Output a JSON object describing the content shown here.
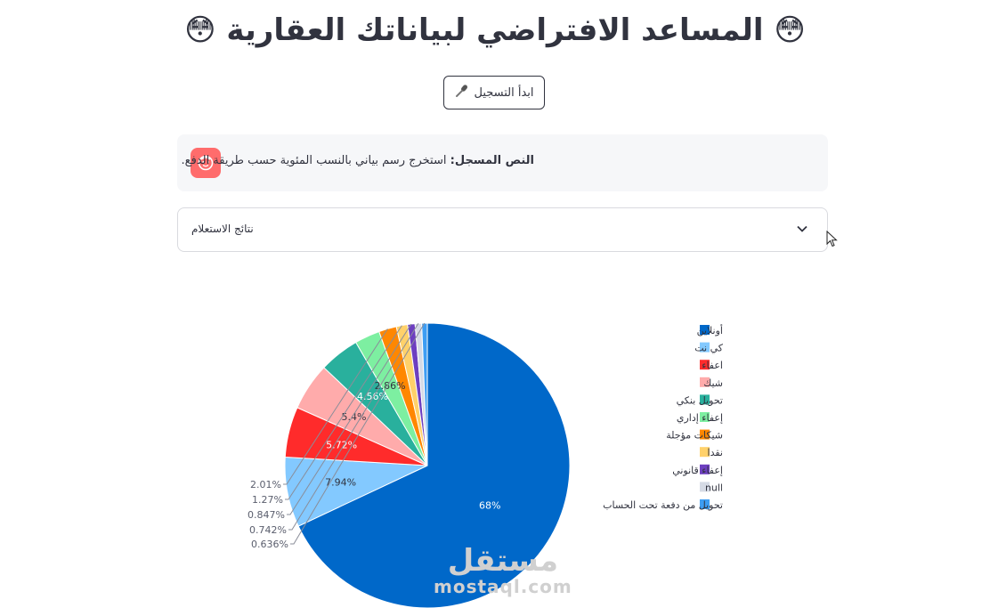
{
  "header": {
    "title": "😳 المساعد الافتراضي لبياناتك العقارية 😳"
  },
  "record_button": {
    "label": "ابدأ التسجيل",
    "icon": "microphone-icon"
  },
  "chat": {
    "prefix": "النص المسجل:",
    "message": "استخرج رسم بياني بالنسب المئوية حسب طريقة الدفع.",
    "avatar_color": "#ff6c6c"
  },
  "expander": {
    "label": "نتائج الاستعلام"
  },
  "watermark": {
    "arabic": "مستقل",
    "latin": "mostaql.com"
  },
  "chart_data": {
    "type": "pie",
    "labels": [
      "أونلاين",
      "كي نت",
      "اعفاء",
      "شيك",
      "تحويل بنكي",
      "إعفاء إداري",
      "شيكات مؤجلة",
      "نقدا",
      "إعفاء قانوني",
      "null",
      "تحويل من دفعة تحت الحساب"
    ],
    "values": [
      68,
      7.94,
      5.72,
      5.4,
      4.56,
      2.86,
      2.01,
      1.27,
      0.847,
      0.742,
      0.636
    ],
    "value_labels": [
      "68%",
      "7.94%",
      "5.72%",
      "5.4%",
      "4.56%",
      "2.86%",
      "2.01%",
      "1.27%",
      "0.847%",
      "0.742%",
      "0.636%"
    ],
    "colors": [
      "#0068c9",
      "#83c9ff",
      "#ff2b2b",
      "#ffabab",
      "#29b09d",
      "#7defa1",
      "#ff8700",
      "#ffd16a",
      "#6d3fc0",
      "#d5dae5",
      "#3d9df3"
    ],
    "legend_position": "right",
    "title": ""
  }
}
